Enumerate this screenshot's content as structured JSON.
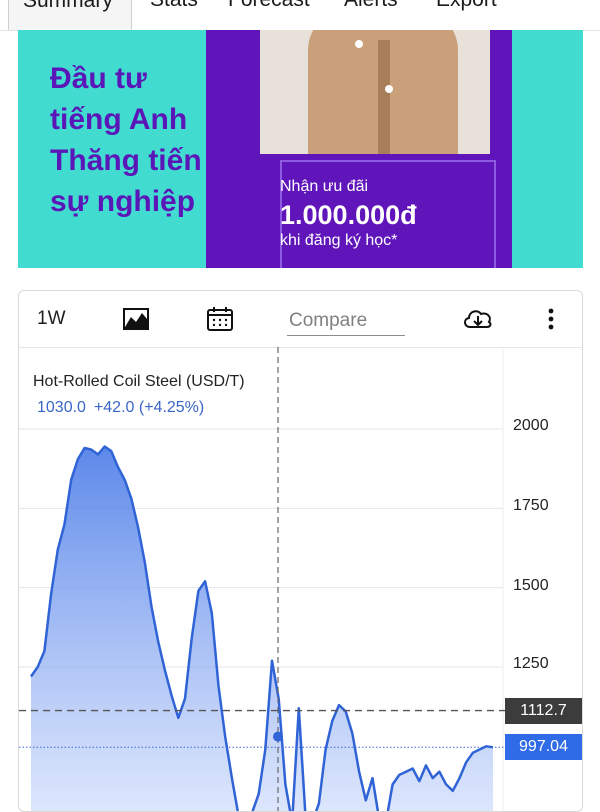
{
  "tabs": [
    {
      "label": "Summary",
      "active": true
    },
    {
      "label": "Stats"
    },
    {
      "label": "Forecast"
    },
    {
      "label": "Alerts"
    },
    {
      "label": "Export"
    }
  ],
  "ad": {
    "headline": [
      "Đầu tư",
      "tiếng Anh",
      "Thăng tiến",
      "sự nghiệp"
    ],
    "offer": "Nhận ưu đãi",
    "amount": "1.000.000đ",
    "note": "khi đăng ký học*"
  },
  "toolbar": {
    "range_label": "1W",
    "compare_placeholder": "Compare",
    "icons": [
      "area-chart-icon",
      "calendar-icon",
      "download-cloud-icon",
      "more-vertical-icon"
    ]
  },
  "legend": {
    "title": "Hot-Rolled Coil Steel (USD/T)",
    "value": "1030.0",
    "change": "+42.0 (+4.25%)"
  },
  "price_tags": {
    "crosshair": "1112.7",
    "last": "997.04"
  },
  "colors": {
    "line": "#2f63d6",
    "crosshair_tag": "#3c3c3c",
    "last_tag": "#2f6be6",
    "ad_teal": "#41dccf",
    "ad_purple": "#6015ba"
  },
  "chart_data": {
    "type": "area",
    "title": "Hot-Rolled Coil Steel (USD/T)",
    "ylim": [
      750,
      2050
    ],
    "yticks": [
      2000,
      1750,
      1500,
      1250
    ],
    "grid": true,
    "values": [
      1220,
      1250,
      1300,
      1480,
      1620,
      1700,
      1840,
      1905,
      1940,
      1935,
      1920,
      1945,
      1930,
      1880,
      1840,
      1780,
      1690,
      1580,
      1440,
      1330,
      1240,
      1160,
      1090,
      1150,
      1340,
      1490,
      1520,
      1420,
      1190,
      1030,
      900,
      780,
      770,
      790,
      850,
      990,
      1270,
      1150,
      880,
      760,
      1120,
      780,
      760,
      820,
      990,
      1080,
      1130,
      1110,
      1040,
      920,
      830,
      900,
      770,
      760,
      880,
      910,
      920,
      930,
      890,
      940,
      900,
      920,
      880,
      860,
      900,
      950,
      980,
      990,
      1000,
      997.04
    ],
    "crosshair_value": 1112.7,
    "last_value": 997.04
  }
}
